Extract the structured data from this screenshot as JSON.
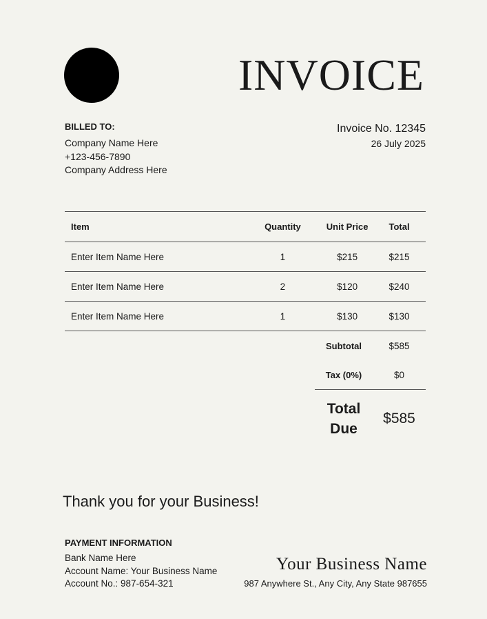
{
  "header": {
    "title": "INVOICE"
  },
  "billed_to": {
    "label": "BILLED TO:",
    "company": "Company Name Here",
    "phone": "+123-456-7890",
    "address": "Company Address Here"
  },
  "invoice": {
    "number": "Invoice No. 12345",
    "date": "26 July 2025"
  },
  "table": {
    "headers": {
      "item": "Item",
      "quantity": "Quantity",
      "unit_price": "Unit Price",
      "total": "Total"
    },
    "rows": [
      {
        "item": "Enter Item Name Here",
        "quantity": "1",
        "unit_price": "$215",
        "total": "$215"
      },
      {
        "item": "Enter Item Name Here",
        "quantity": "2",
        "unit_price": "$120",
        "total": "$240"
      },
      {
        "item": "Enter Item Name Here",
        "quantity": "1",
        "unit_price": "$130",
        "total": "$130"
      }
    ]
  },
  "summary": {
    "subtotal_label": "Subtotal",
    "subtotal_value": "$585",
    "tax_label": "Tax (0%)",
    "tax_value": "$0",
    "due_label_line1": "Total",
    "due_label_line2": "Due",
    "due_value": "$585"
  },
  "thanks": "Thank you for your Business!",
  "payment": {
    "label": "PAYMENT INFORMATION",
    "bank": "Bank Name Here",
    "account_name": "Account Name: Your Business Name",
    "account_no": "Account No.: 987-654-321"
  },
  "business": {
    "name": "Your Business Name",
    "address": "987 Anywhere St., Any City, Any State 987655"
  }
}
